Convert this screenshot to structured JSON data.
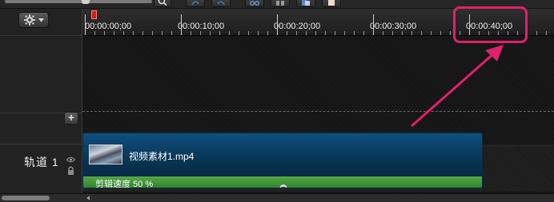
{
  "ruler": {
    "timecodes": [
      "00:00:00;00",
      "00:00:10;00",
      "00:00:20;00",
      "00:00:30;00",
      "00:00:40;00"
    ]
  },
  "track": {
    "label": "轨道 1"
  },
  "clip": {
    "name": "视频素材1.mp4",
    "speed_label": "剪辑速度 50 %"
  },
  "icons": {
    "gear": "gear-icon",
    "add": "plus-icon",
    "eye": "eye-icon",
    "lock": "lock-icon",
    "search": "search-icon",
    "undo": "undo-icon",
    "redo": "redo-icon",
    "cut": "scissors-icon",
    "split": "split-icon",
    "copy": "copy-icon",
    "paste": "paste-icon"
  },
  "colors": {
    "annotation": "#e2206a",
    "clip_body": "#0f4f7e",
    "clip_speed_bar": "#3f8f35",
    "playhead": "#cc2020"
  }
}
